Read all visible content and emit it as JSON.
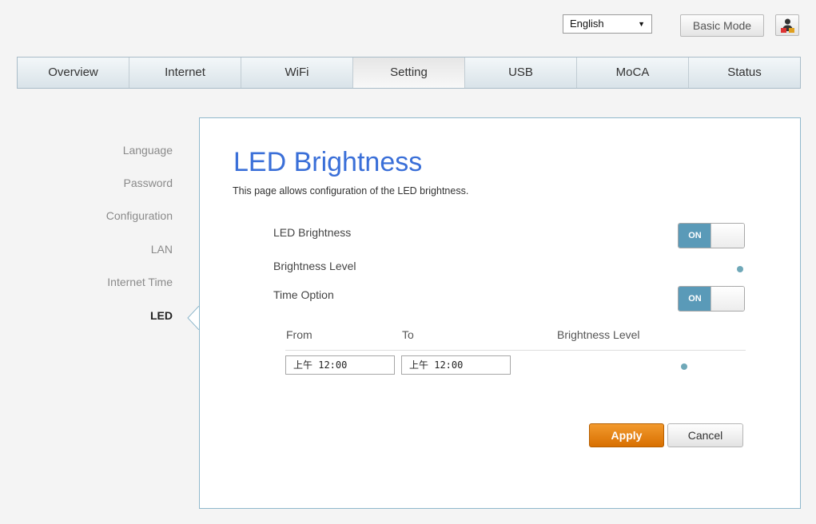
{
  "header": {
    "language_selected": "English",
    "mode_button": "Basic Mode",
    "user_icon": "user-icon"
  },
  "nav": {
    "tabs": [
      {
        "label": "Overview"
      },
      {
        "label": "Internet"
      },
      {
        "label": "WiFi"
      },
      {
        "label": "Setting",
        "active": true
      },
      {
        "label": "USB"
      },
      {
        "label": "MoCA"
      },
      {
        "label": "Status"
      }
    ]
  },
  "sidebar": {
    "items": [
      {
        "label": "Language"
      },
      {
        "label": "Password"
      },
      {
        "label": "Configuration"
      },
      {
        "label": "LAN"
      },
      {
        "label": "Internet Time"
      },
      {
        "label": "LED",
        "active": true
      }
    ]
  },
  "main": {
    "title": "LED Brightness",
    "description": "This page allows configuration of the LED brightness.",
    "led_brightness_label": "LED Brightness",
    "led_brightness_toggle": "ON",
    "brightness_level_label": "Brightness Level",
    "time_option_label": "Time Option",
    "time_option_toggle": "ON",
    "table": {
      "col_from": "From",
      "col_to": "To",
      "col_level": "Brightness Level",
      "from_value": "上午 12:00",
      "to_value": "上午 12:00"
    },
    "apply_label": "Apply",
    "cancel_label": "Cancel"
  },
  "colors": {
    "accent_title": "#3a6fd8",
    "toggle_on": "#5a9ab8",
    "apply": "#e07c0a",
    "slider_dot": "#6fa8b8"
  }
}
